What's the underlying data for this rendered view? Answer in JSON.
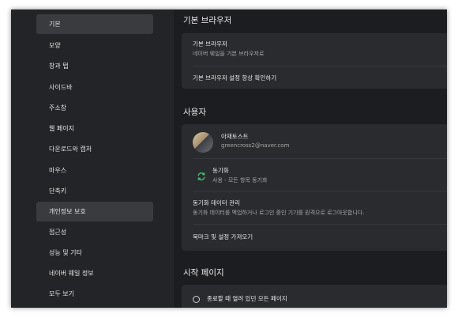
{
  "sidebar": {
    "items": [
      {
        "label": "기본"
      },
      {
        "label": "모양"
      },
      {
        "label": "창과 탭"
      },
      {
        "label": "사이드바"
      },
      {
        "label": "주소창"
      },
      {
        "label": "웹 페이지"
      },
      {
        "label": "다운로드와 캡처"
      },
      {
        "label": "마우스"
      },
      {
        "label": "단축키"
      },
      {
        "label": "개인정보 보호"
      },
      {
        "label": "접근성"
      },
      {
        "label": "성능 및 기타"
      },
      {
        "label": "네이버 웨일 정보"
      },
      {
        "label": "모두 보기"
      }
    ]
  },
  "default_browser": {
    "title": "기본 브라우저",
    "row_title": "기본 브라우저",
    "row_sub": "네이버 웨일을 기본 브라우저로",
    "check_label": "기본 브라우저 설정 항상 확인하기"
  },
  "user": {
    "title": "사용자",
    "name": "아재토스트",
    "email": "greencross2@naver.com",
    "sync_title": "동기화",
    "sync_sub": "사용 - 모든 항목 동기화",
    "manage_title": "동기화 데이터 관리",
    "manage_sub": "동기화 데이터를 백업하거나 로그인 중인 기기를 원격으로 로그아웃합니다.",
    "import_label": "북마크 및 설정 가져오기"
  },
  "start_page": {
    "title": "시작 페이지",
    "option1": "종료할 때 열려 있던 모든 페이지"
  },
  "icons": {
    "sync": "sync-icon",
    "avatar": "avatar",
    "radio": "radio-button"
  },
  "colors": {
    "sync_green": "#3ec46d",
    "active_item_bg": "#3a3b3f"
  }
}
